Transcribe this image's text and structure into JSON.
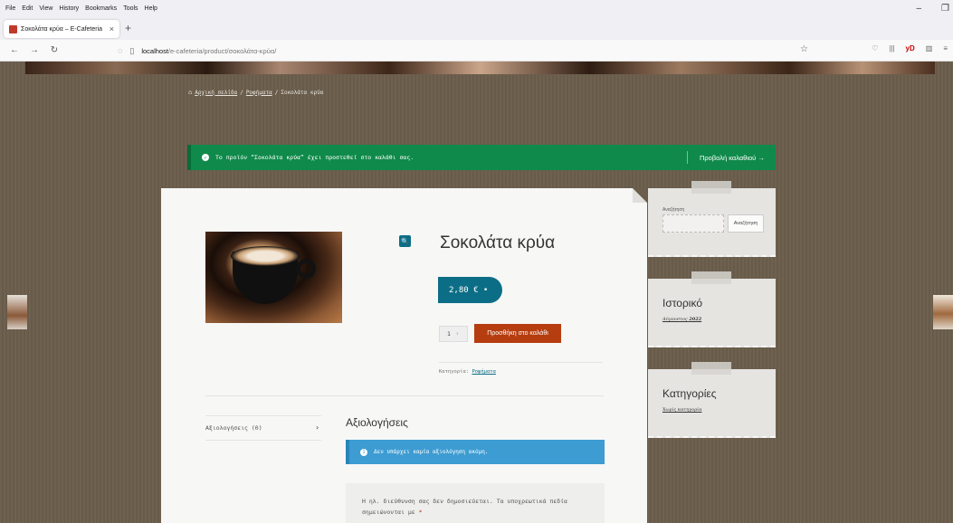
{
  "browser": {
    "menu": [
      "File",
      "Edit",
      "View",
      "History",
      "Bookmarks",
      "Tools",
      "Help"
    ],
    "tab_title": "Σοκολάτα κρύα – E-Cafeteria",
    "url_host": "localhost",
    "url_path": "/e-cafeteria/product/σοκολάτα-κρύα/"
  },
  "breadcrumb": {
    "home": "Αρχική σελίδα",
    "sep": "/",
    "category": "Ροφήματα",
    "current": "Σοκολάτα κρύα"
  },
  "notice": {
    "message": "Το προϊόν “Σοκολάτα κρύα” έχει προστεθεί στο καλάθι σας.",
    "view_cart": "Προβολή καλαθιού →"
  },
  "product": {
    "title": "Σοκολάτα κρύα",
    "price": "2,80 € •",
    "quantity": "1",
    "add_to_cart": "Προσθήκη στο καλάθι",
    "category_label": "Κατηγορία:",
    "category_value": "Ροφήματα",
    "zoom_glyph": "🔍"
  },
  "reviews": {
    "tab_label": "Αξιολογήσεις (0)",
    "heading": "Αξιολογήσεις",
    "empty_notice": "Δεν υπάρχει καμία αξιολόγηση ακόμη.",
    "form_note": "Η ηλ. διεύθυνση σας δεν δημοσιεύεται. Τα υποχρεωτικά πεδία σημειώνονται με",
    "required_mark": "*"
  },
  "sidebar": {
    "search_label": "Αναζήτηση",
    "search_button": "Αναζήτηση",
    "history_title": "Ιστορικό",
    "history_link_month": "Αύγουστος",
    "history_link_year": "2022",
    "categories_title": "Κατηγορίες",
    "categories_link": "Χωρίς κατηγορία"
  }
}
